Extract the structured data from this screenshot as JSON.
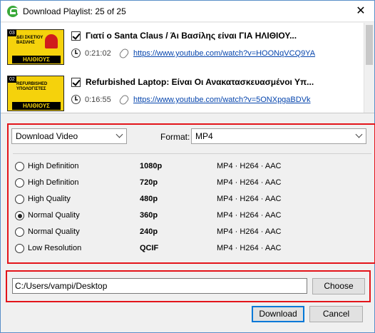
{
  "window": {
    "title": "Download Playlist: 25 of 25",
    "close_glyph": "✕"
  },
  "playlist": [
    {
      "number": "03",
      "thumb_line1": "ΔΕΙ ΣΚΕΤΙΟΥ",
      "thumb_line2": "ΒΑΣΙΛΗΣ",
      "thumb_brand": "ΗΛΙΘΙΟΥΣ",
      "title": "Γιατί ο Santa Claus / Άι Βασίλης είναι ΓΙΑ ΗΛΙΘΙΟΥ...",
      "duration": "0:21:02",
      "url": "https://www.youtube.com/watch?v=HOONqVCQ9YA",
      "checked": true
    },
    {
      "number": "02",
      "thumb_line1": "REFURBISHED",
      "thumb_line2": "ΥΠΟΛΟΓΙΣΤΕΣ",
      "thumb_brand": "ΗΛΙΘΙΟΥΣ",
      "title": "Refurbished Laptop: Είναι Οι Ανακατασκευασμένοι Υπ...",
      "duration": "0:16:55",
      "url": "https://www.youtube.com/watch?v=5ONXpgaBDVk",
      "checked": true
    }
  ],
  "options": {
    "type_value": "Download Video",
    "format_label": "Format:",
    "format_value": "MP4",
    "qualities": [
      {
        "name": "High Definition",
        "res": "1080p",
        "codec": "MP4 · H264 · AAC",
        "selected": false
      },
      {
        "name": "High Definition",
        "res": "720p",
        "codec": "MP4 · H264 · AAC",
        "selected": false
      },
      {
        "name": "High Quality",
        "res": "480p",
        "codec": "MP4 · H264 · AAC",
        "selected": false
      },
      {
        "name": "Normal Quality",
        "res": "360p",
        "codec": "MP4 · H264 · AAC",
        "selected": true
      },
      {
        "name": "Normal Quality",
        "res": "240p",
        "codec": "MP4 · H264 · AAC",
        "selected": false
      },
      {
        "name": "Low Resolution",
        "res": "QCIF",
        "codec": "MP4 · H264 · AAC",
        "selected": false
      }
    ]
  },
  "destination": {
    "path": "C:/Users/vampi/Desktop",
    "choose_label": "Choose"
  },
  "footer": {
    "download_label": "Download",
    "cancel_label": "Cancel"
  },
  "colors": {
    "highlight": "#e3141a",
    "link": "#0645ad",
    "thumb_bg": "#f5d20c"
  }
}
